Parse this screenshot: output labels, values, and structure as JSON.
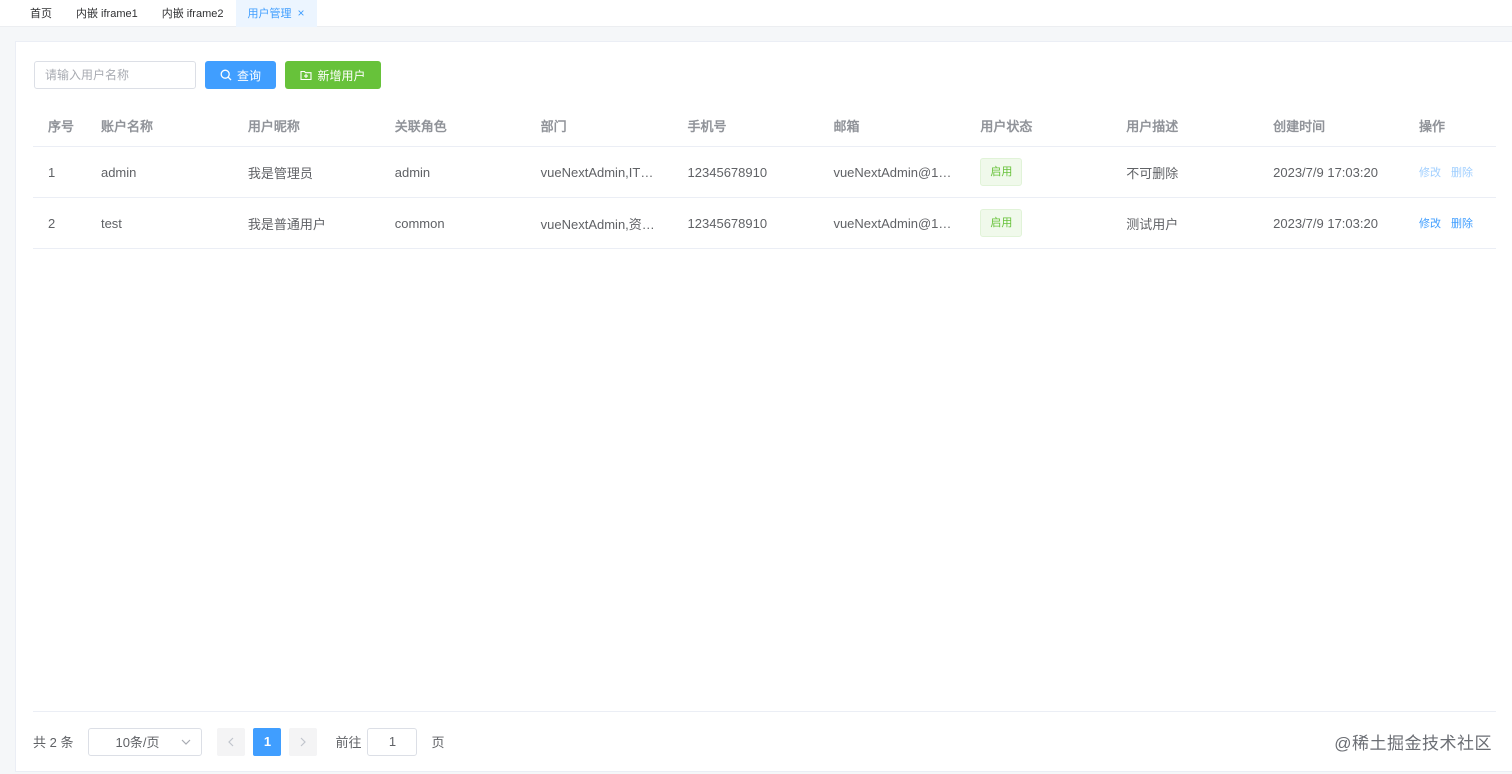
{
  "tabs": [
    {
      "label": "首页",
      "active": false
    },
    {
      "label": "内嵌 iframe1",
      "active": false
    },
    {
      "label": "内嵌 iframe2",
      "active": false
    },
    {
      "label": "用户管理",
      "active": true
    }
  ],
  "toolbar": {
    "search_placeholder": "请输入用户名称",
    "query_label": "查询",
    "add_label": "新增用户"
  },
  "table": {
    "columns": [
      "序号",
      "账户名称",
      "用户昵称",
      "关联角色",
      "部门",
      "手机号",
      "邮箱",
      "用户状态",
      "用户描述",
      "创建时间",
      "操作"
    ],
    "rows": [
      {
        "index": "1",
        "account": "admin",
        "nickname": "我是管理员",
        "role": "admin",
        "dept": "vueNextAdmin,IT…",
        "phone": "12345678910",
        "email": "vueNextAdmin@1…",
        "status": "启用",
        "desc": "不可删除",
        "created": "2023/7/9 17:03:20",
        "edit": "修改",
        "delete": "删除"
      },
      {
        "index": "2",
        "account": "test",
        "nickname": "我是普通用户",
        "role": "common",
        "dept": "vueNextAdmin,资…",
        "phone": "12345678910",
        "email": "vueNextAdmin@1…",
        "status": "启用",
        "desc": "测试用户",
        "created": "2023/7/9 17:03:20",
        "edit": "修改",
        "delete": "删除"
      }
    ]
  },
  "pagination": {
    "total_label": "共 2 条",
    "page_size": "10条/页",
    "current_page": "1",
    "goto_label": "前往",
    "goto_value": "1",
    "page_suffix": "页"
  },
  "watermark": "@稀土掘金技术社区",
  "colors": {
    "primary": "#409eff",
    "success": "#67c23a",
    "tag_bg": "#f0f9eb"
  }
}
